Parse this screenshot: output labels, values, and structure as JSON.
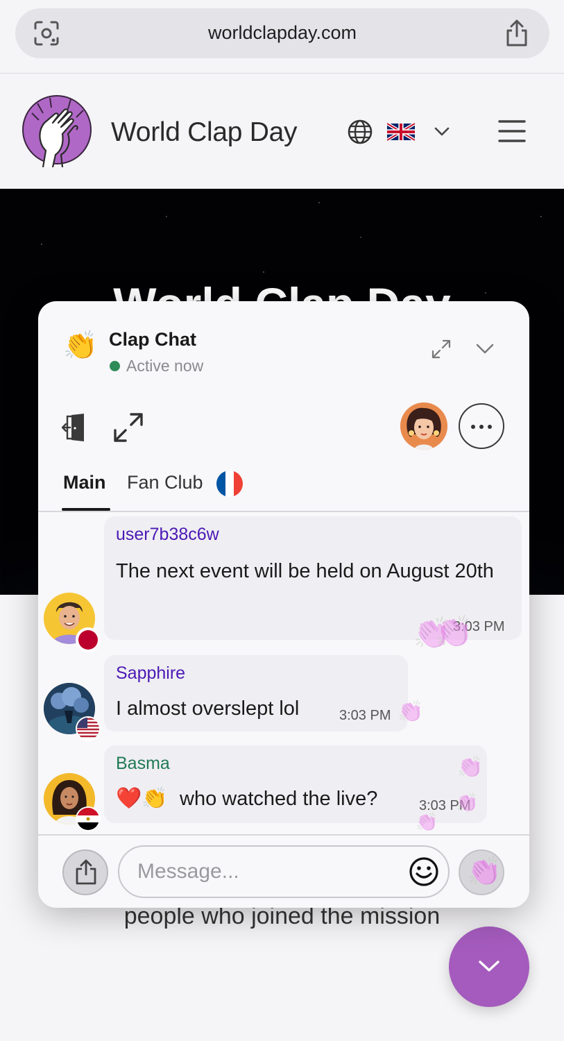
{
  "browser": {
    "url": "worldclapday.com"
  },
  "site": {
    "title": "World Clap Day",
    "hero_title": "World Clap Day",
    "below_text": "people who joined the mission"
  },
  "colors": {
    "accent": "#a45bbd",
    "online": "#2e8b57",
    "username_purple": "#4b19b5",
    "username_green": "#1f7a55"
  },
  "chat": {
    "emoji": "👏",
    "title": "Clap Chat",
    "status": "Active now",
    "tabs": [
      {
        "label": "Main",
        "active": true
      },
      {
        "label": "Fan Club",
        "active": false
      }
    ],
    "messages": [
      {
        "user": "user7b38c6w",
        "text": "The next event will be held on August 20th",
        "time": "3:03 PM",
        "flag": "japan"
      },
      {
        "user": "Sapphire",
        "text": "I almost overslept lol",
        "time": "3:03 PM",
        "flag": "usa"
      },
      {
        "user": "Basma",
        "text_emoji": "❤️👏",
        "text": "who watched the live?",
        "time": "3:03 PM",
        "flag": "egypt"
      }
    ],
    "composer": {
      "placeholder": "Message..."
    }
  },
  "icons": {
    "lens": "camera-search-icon",
    "share": "share-icon",
    "globe": "globe-icon",
    "menu": "hamburger-icon",
    "expand": "expand-icon",
    "collapse": "chevron-down-icon",
    "exit": "exit-door-icon",
    "more": "more-icon",
    "emoji": "smiley-icon",
    "clap": "clap-icon"
  }
}
